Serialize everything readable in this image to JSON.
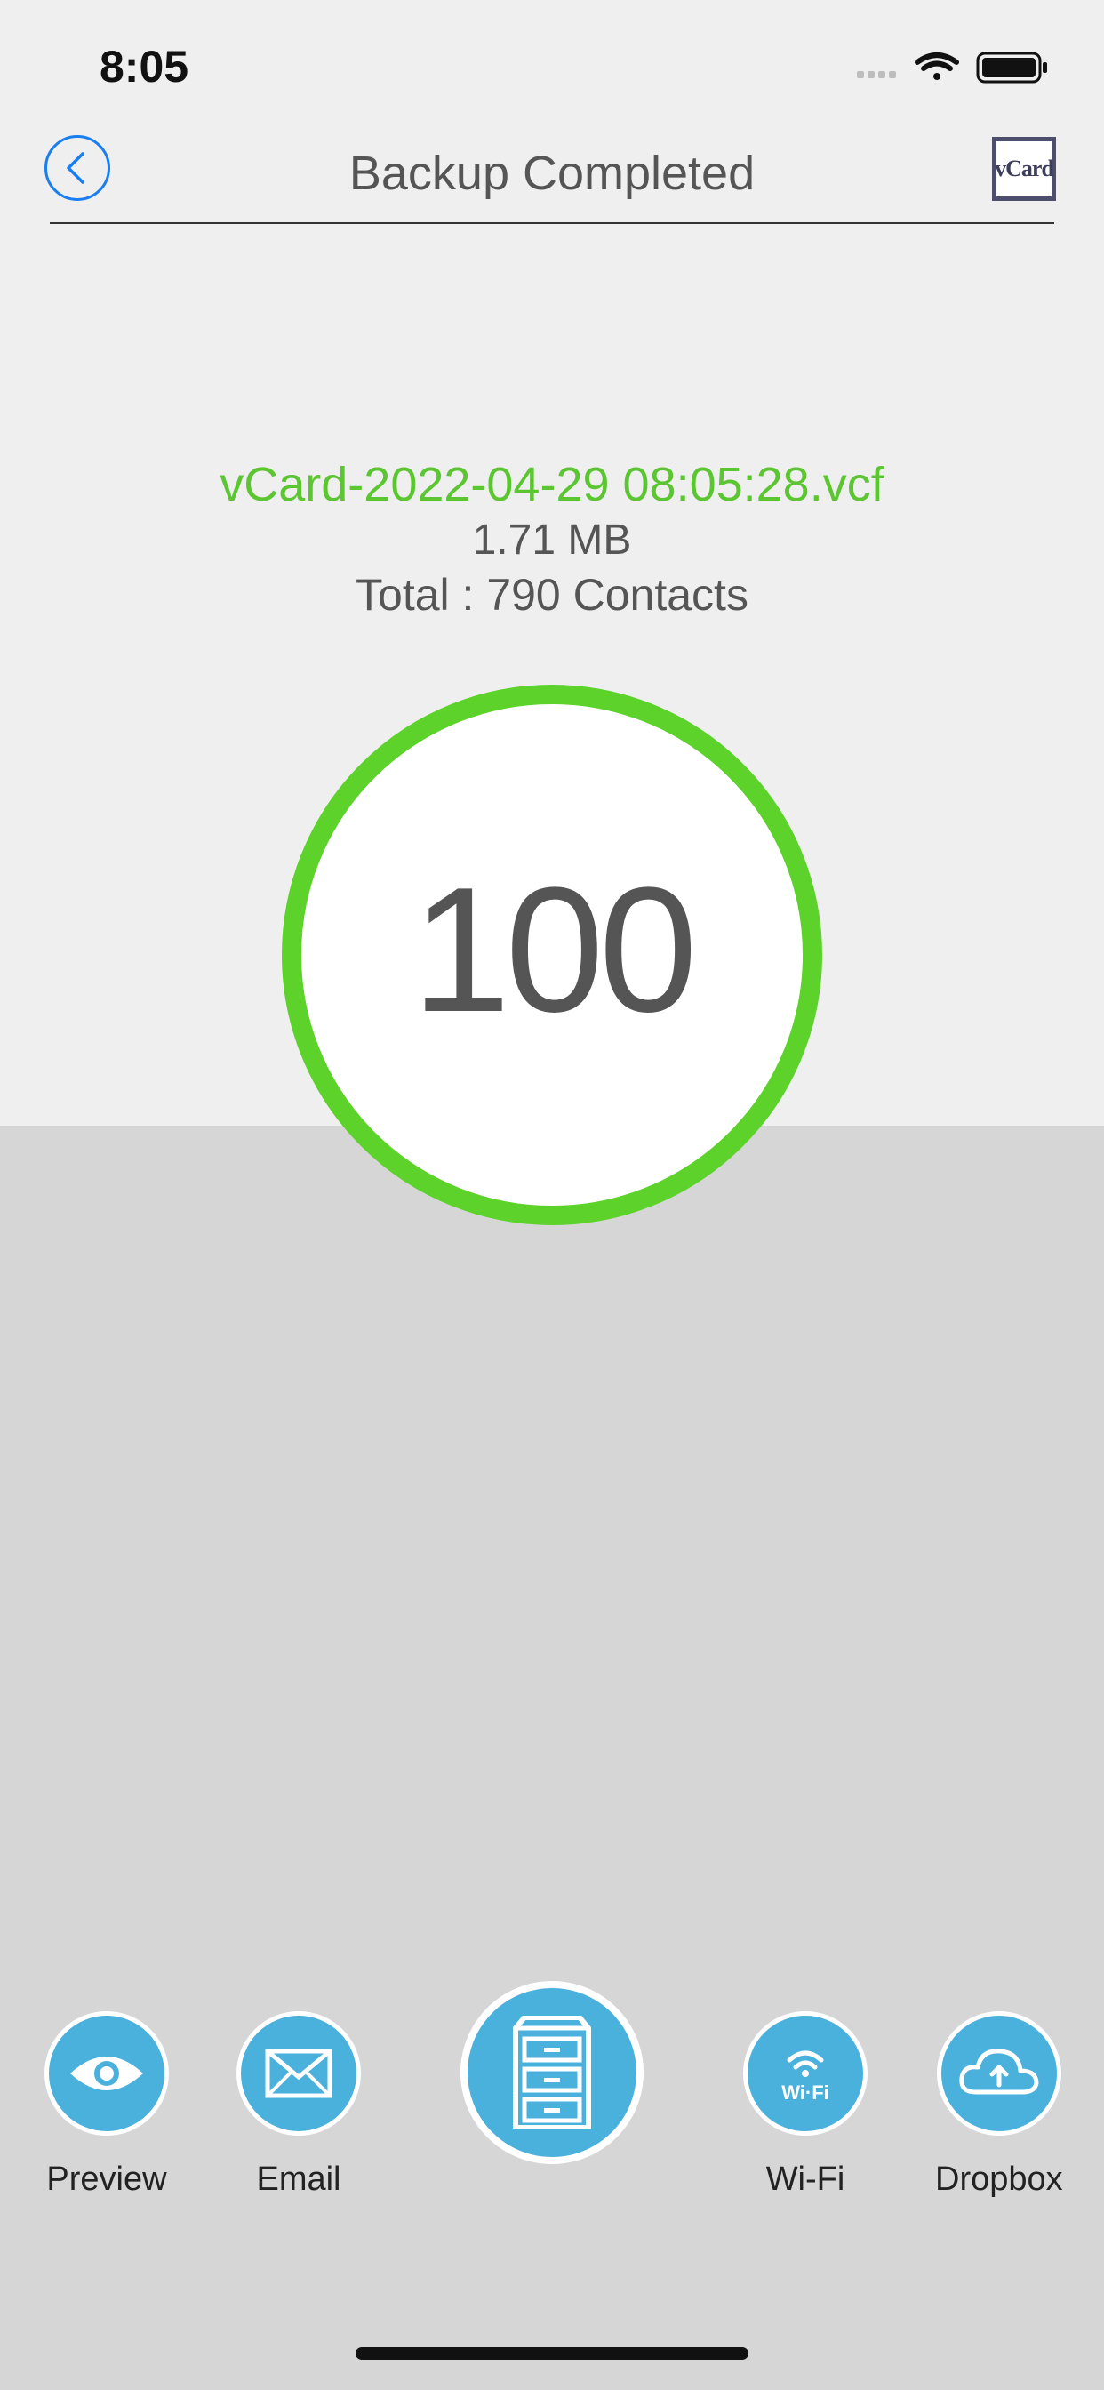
{
  "status_bar": {
    "time": "8:05"
  },
  "nav": {
    "title": "Backup Completed",
    "vcard_label": "vCard"
  },
  "backup": {
    "file_name": "vCard-2022-04-29 08:05:28.vcf",
    "file_size": "1.71 MB",
    "total": "Total : 790 Contacts",
    "progress": "100"
  },
  "actions": {
    "preview": "Preview",
    "email": "Email",
    "wifi": "Wi-Fi",
    "wifi_badge": "Wi·Fi",
    "dropbox": "Dropbox"
  },
  "colors": {
    "accent_blue": "#4ab0dc",
    "success_green": "#5cd22a",
    "filename_green": "#5cc632",
    "ios_blue": "#1a7ef0"
  }
}
